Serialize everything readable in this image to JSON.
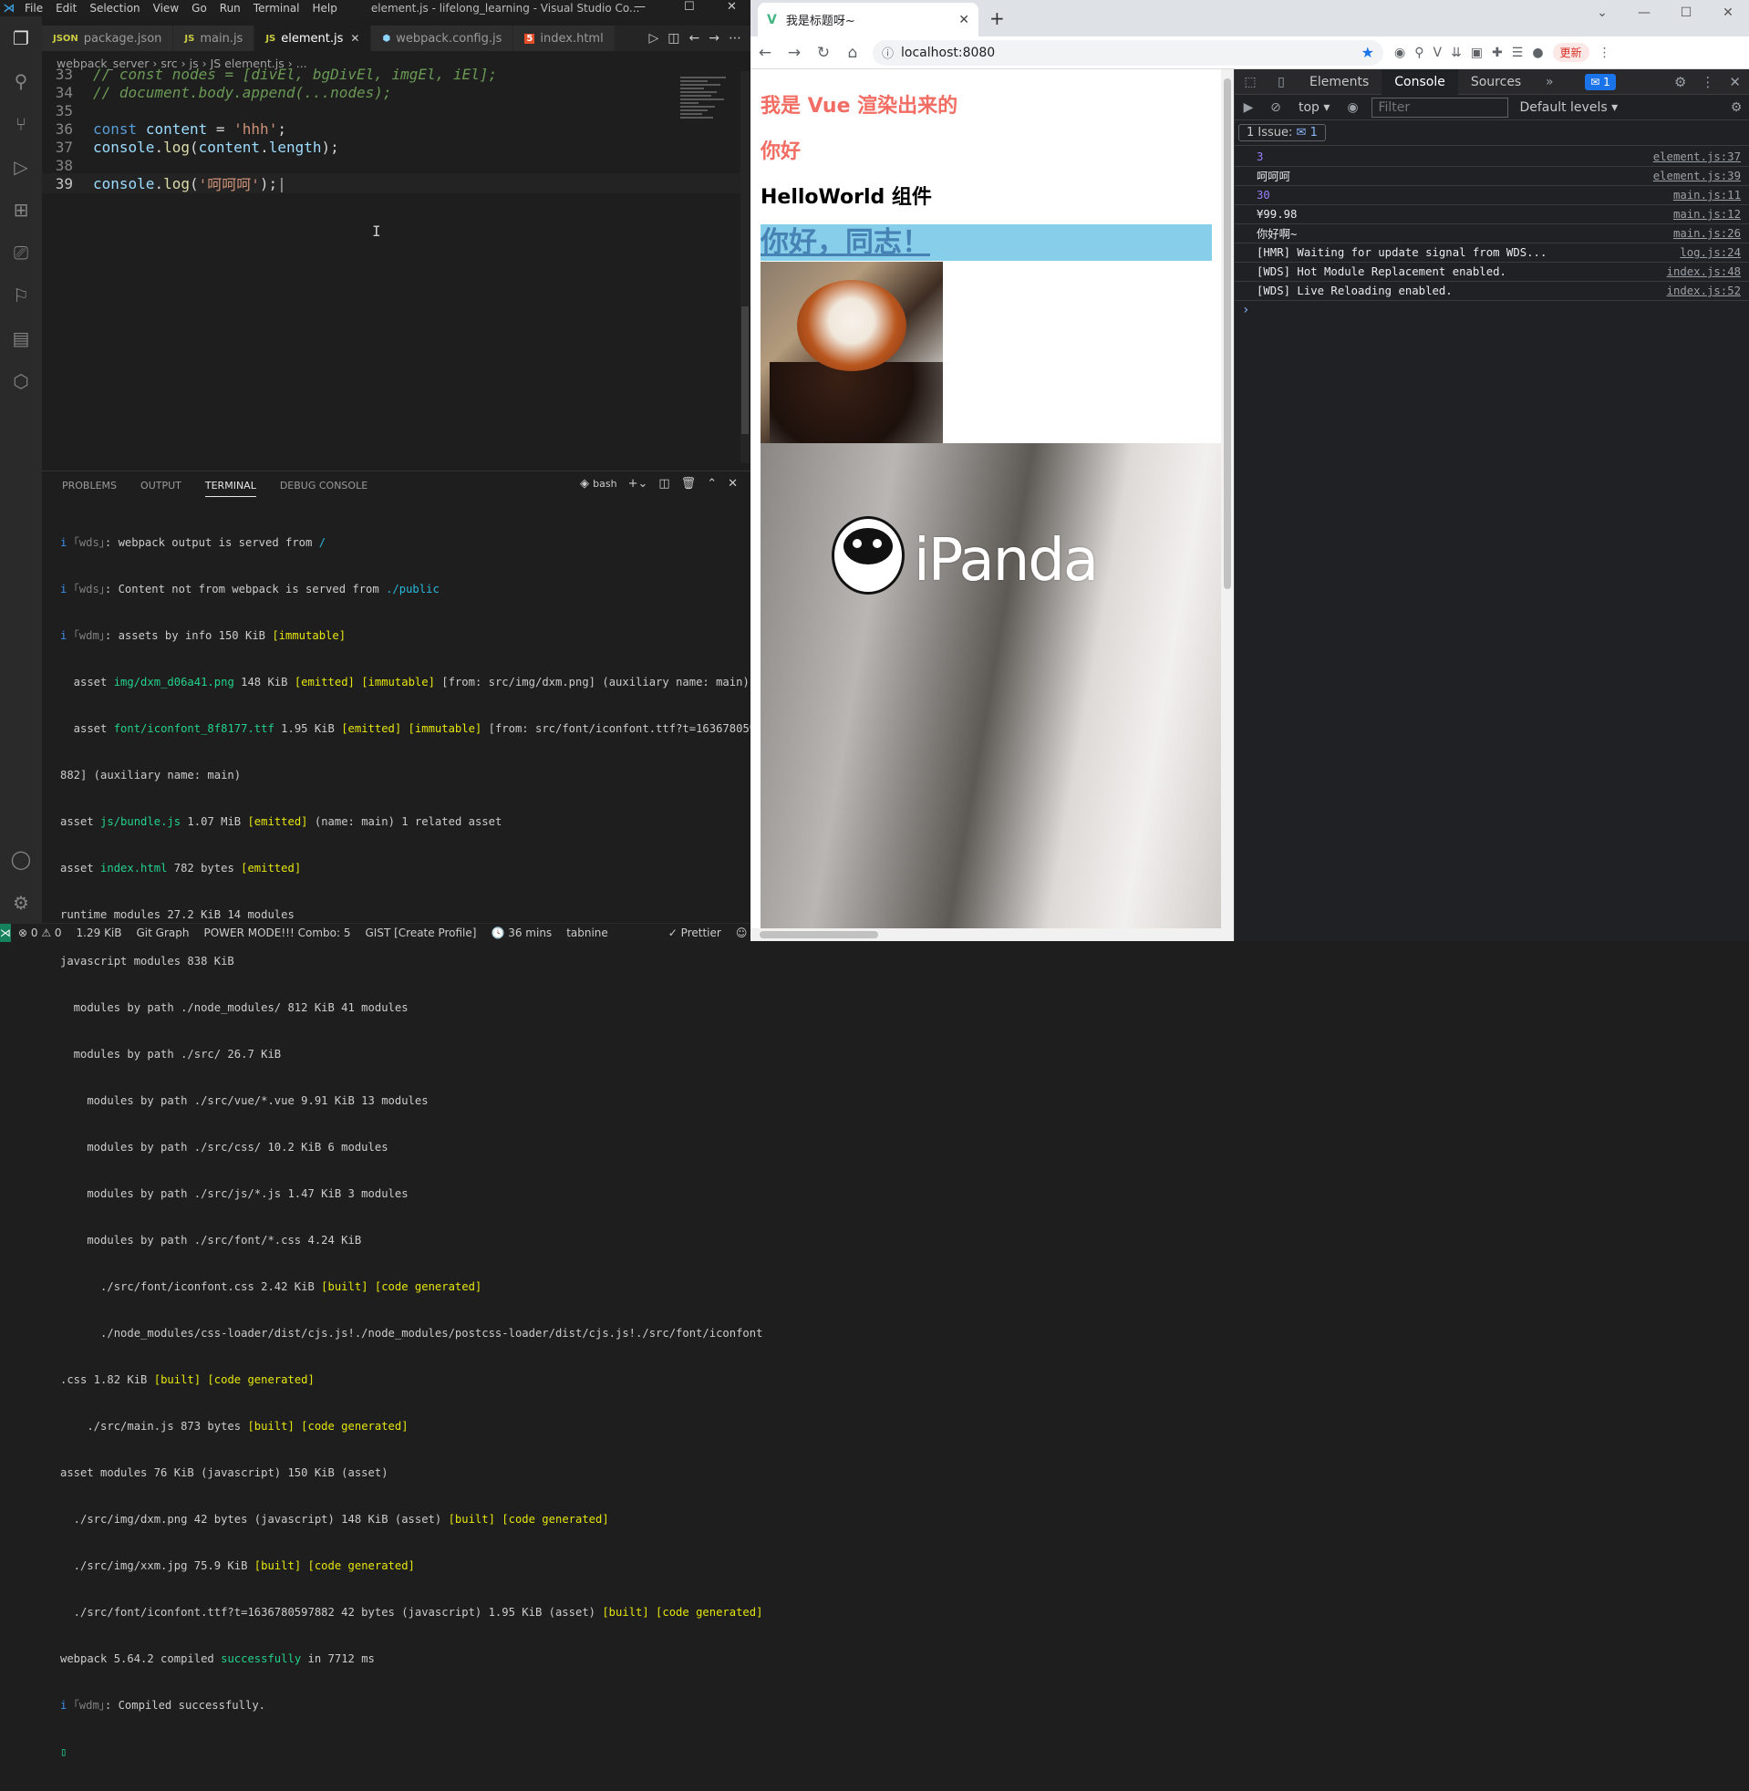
{
  "vscode": {
    "menu": [
      "File",
      "Edit",
      "Selection",
      "View",
      "Go",
      "Run",
      "Terminal",
      "Help"
    ],
    "window_title": "element.js - lifelong_learning - Visual Studio Co...",
    "tabs": [
      {
        "icon": "JSON",
        "label": "package.json"
      },
      {
        "icon": "JS",
        "label": "main.js"
      },
      {
        "icon": "JS",
        "label": "element.js",
        "active": true
      },
      {
        "icon": "⬢",
        "label": "webpack.config.js"
      },
      {
        "icon": "5",
        "label": "index.html"
      }
    ],
    "breadcrumb": [
      "webpack_server",
      "src",
      "js",
      "JS element.js",
      "..."
    ],
    "code": [
      {
        "num": "33",
        "text": "// const nodes = [divEl, bgDivEl, imgEl, iEl];"
      },
      {
        "num": "34",
        "text": "// document.body.append(...nodes);"
      },
      {
        "num": "35",
        "text": ""
      },
      {
        "num": "36",
        "kw": "const",
        "var": "content",
        "op": " = ",
        "str": "'hhh'",
        "end": ";"
      },
      {
        "num": "37",
        "obj": "console",
        "fn": "log",
        "arg": "content",
        "prop": "length",
        "end": ");"
      },
      {
        "num": "38",
        "text": ""
      },
      {
        "num": "39",
        "obj": "console",
        "fn": "log",
        "str": "'呵呵呵'",
        "end": ");"
      }
    ],
    "panel_tabs": [
      "PROBLEMS",
      "OUTPUT",
      "TERMINAL",
      "DEBUG CONSOLE"
    ],
    "shell": "bash",
    "terminal_lines": [
      "i ｢wds｣: webpack output is served from /",
      "i ｢wds｣: Content not from webpack is served from ./public",
      "i ｢wdm｣: assets by info 150 KiB [immutable]",
      "  asset img/dxm_d06a41.png 148 KiB [emitted] [immutable] [from: src/img/dxm.png] (auxiliary name: main)",
      "  asset font/iconfont_8f8177.ttf 1.95 KiB [emitted] [immutable] [from: src/font/iconfont.ttf?t=1636780597",
      "882] (auxiliary name: main)",
      "asset js/bundle.js 1.07 MiB [emitted] (name: main) 1 related asset",
      "asset index.html 782 bytes [emitted]",
      "runtime modules 27.2 KiB 14 modules",
      "javascript modules 838 KiB",
      "  modules by path ./node_modules/ 812 KiB 41 modules",
      "  modules by path ./src/ 26.7 KiB",
      "    modules by path ./src/vue/*.vue 9.91 KiB 13 modules",
      "    modules by path ./src/css/ 10.2 KiB 6 modules",
      "    modules by path ./src/js/*.js 1.47 KiB 3 modules",
      "    modules by path ./src/font/*.css 4.24 KiB",
      "      ./src/font/iconfont.css 2.42 KiB [built] [code generated]",
      "      ./node_modules/css-loader/dist/cjs.js!./node_modules/postcss-loader/dist/cjs.js!./src/font/iconfont",
      ".css 1.82 KiB [built] [code generated]",
      "    ./src/main.js 873 bytes [built] [code generated]",
      "asset modules 76 KiB (javascript) 150 KiB (asset)",
      "  ./src/img/dxm.png 42 bytes (javascript) 148 KiB (asset) [built] [code generated]",
      "  ./src/img/xxm.jpg 75.9 KiB [built] [code generated]",
      "  ./src/font/iconfont.ttf?t=1636780597882 42 bytes (javascript) 1.95 KiB (asset) [built] [code generated]",
      "webpack 5.64.2 compiled successfully in 7712 ms",
      "i ｢wdm｣: Compiled successfully."
    ],
    "status": {
      "errors": "⊗ 0 ⚠ 0",
      "size": "1.29 KiB",
      "git_graph": "Git Graph",
      "power_mode": "POWER MODE!!! Combo: 5",
      "gist": "GIST [Create Profile]",
      "time": "🕓 36 mins",
      "tabnine": "tabnine",
      "prettier": "✓ Prettier"
    }
  },
  "browser": {
    "tab_title": "我是标题呀~",
    "url": "localhost:8080",
    "update_label": "更新",
    "page": {
      "h1": "我是 Vue 渲染出来的",
      "h2": "你好",
      "h3": "HelloWorld 组件",
      "link": "你好，同志！",
      "ipanda_logo": "iPanda"
    }
  },
  "devtools": {
    "tabs": [
      "Elements",
      "Console",
      "Sources"
    ],
    "active_tab": "Console",
    "badge": "1",
    "context": "top",
    "filter_placeholder": "Filter",
    "levels": "Default levels",
    "issues_label": "1 Issue:",
    "issues_count": "1",
    "console_rows": [
      {
        "msg": "3",
        "src": "element.js:37",
        "num": true
      },
      {
        "msg": "呵呵呵",
        "src": "element.js:39"
      },
      {
        "msg": "30",
        "src": "main.js:11",
        "num": true
      },
      {
        "msg": "¥99.98",
        "src": "main.js:12"
      },
      {
        "msg": "你好啊~",
        "src": "main.js:26"
      },
      {
        "msg": "[HMR] Waiting for update signal from WDS...",
        "src": "log.js:24"
      },
      {
        "msg": "[WDS] Hot Module Replacement enabled.",
        "src": "index.js:48"
      },
      {
        "msg": "[WDS] Live Reloading enabled.",
        "src": "index.js:52"
      }
    ]
  }
}
